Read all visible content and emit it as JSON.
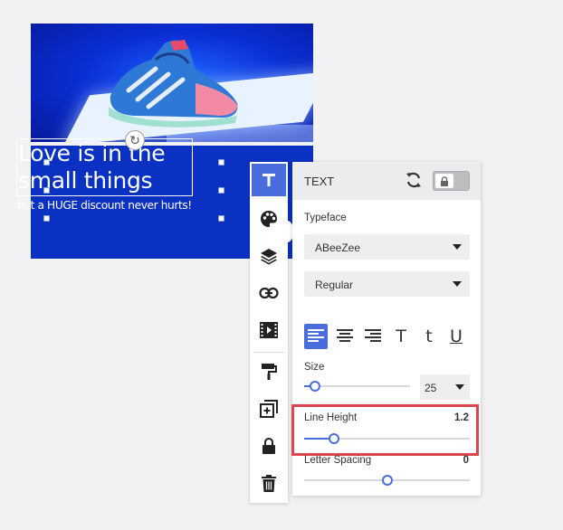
{
  "canvas": {
    "headline_line1": "Love is in the",
    "headline_line2": "small things",
    "subline": "but a HUGE discount never hurts!",
    "photo_icon": "sneaker-image",
    "rotate_icon": "rotate-icon",
    "banner_color": "#0a31c2"
  },
  "toolbar": {
    "tools": [
      {
        "name": "text-tool",
        "icon": "text-T-icon",
        "active": true
      },
      {
        "name": "color-tool",
        "icon": "palette-icon"
      },
      {
        "name": "layers-tool",
        "icon": "layers-icon"
      },
      {
        "name": "link-tool",
        "icon": "link-icon"
      },
      {
        "name": "animation-tool",
        "icon": "film-icon"
      },
      {
        "name": "format-painter-tool",
        "icon": "paint-roller-icon"
      },
      {
        "name": "duplicate-tool",
        "icon": "duplicate-icon"
      },
      {
        "name": "lock-tool",
        "icon": "lock-icon"
      },
      {
        "name": "delete-tool",
        "icon": "trash-icon"
      }
    ],
    "accent": "#4a6dde"
  },
  "panel": {
    "title": "TEXT",
    "typeface_label": "Typeface",
    "typeface_value": "ABeeZee",
    "style_value": "Regular",
    "alignment_options": [
      "align-left",
      "align-center",
      "align-right",
      "uppercase",
      "lowercase",
      "underline"
    ],
    "alignment_glyphs": {
      "uppercase": "T",
      "lowercase": "t",
      "underline": "U"
    },
    "alignment_active": "align-left",
    "size_label": "Size",
    "size_value": "25",
    "size_fraction": 0.1,
    "line_height_label": "Line Height",
    "line_height_value": "1.2",
    "line_height_fraction": 0.18,
    "letter_spacing_label": "Letter Spacing",
    "letter_spacing_value": "0",
    "letter_spacing_fraction": 0.5,
    "highlight_color": "#d9474c"
  }
}
